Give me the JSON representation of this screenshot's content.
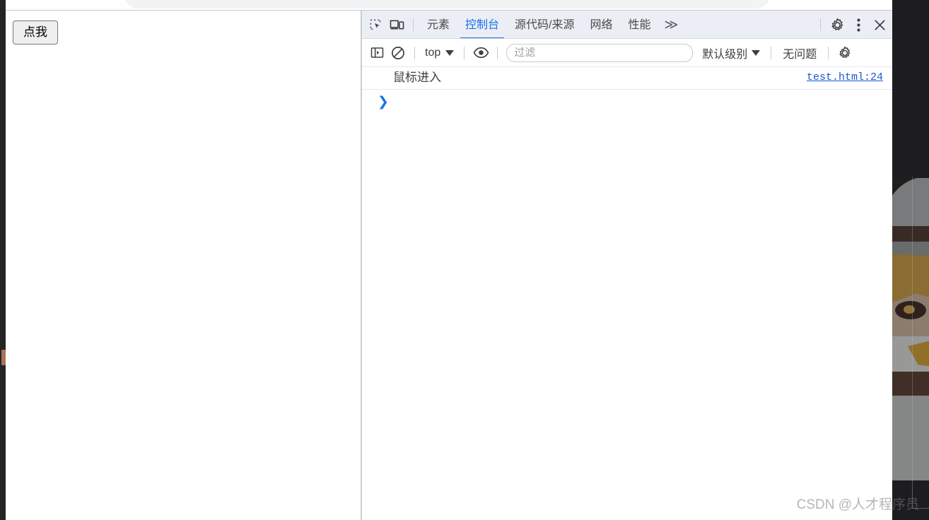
{
  "desktop": {
    "background_color": "#1d1d1f",
    "wallpaper_note": "anime-character-wallpaper"
  },
  "browser": {
    "omnibox": {
      "value": "",
      "placeholder": ""
    },
    "page": {
      "button_label": "点我"
    }
  },
  "devtools": {
    "toolbar": {
      "inspect_icon": "inspect-element-icon",
      "device_icon": "device-toolbar-icon",
      "tabs": [
        {
          "label": "元素",
          "active": false
        },
        {
          "label": "控制台",
          "active": true
        },
        {
          "label": "源代码/来源",
          "active": false
        },
        {
          "label": "网络",
          "active": false
        },
        {
          "label": "性能",
          "active": false
        }
      ],
      "more_tabs_label": "≫",
      "settings_icon": "gear-icon",
      "kebab_icon": "more-vertical-icon",
      "close_icon": "close-icon"
    },
    "console_toolbar": {
      "sidebar_icon": "console-sidebar-icon",
      "clear_icon": "clear-console-icon",
      "context_label": "top",
      "eye_icon": "live-expression-eye-icon",
      "filter_placeholder": "过滤",
      "filter_value": "",
      "level_label": "默认级别",
      "issues_label": "无问题",
      "settings_icon": "gear-icon"
    },
    "console_messages": [
      {
        "text": "鼠标进入",
        "source": "test.html:24"
      }
    ],
    "prompt": {
      "caret": "❯",
      "value": ""
    }
  },
  "watermark": {
    "text": "CSDN @人才程序员"
  },
  "colors": {
    "accent_blue": "#1a73e8",
    "tabbar_bg": "#ebeef5",
    "link_blue": "#1a56db"
  }
}
